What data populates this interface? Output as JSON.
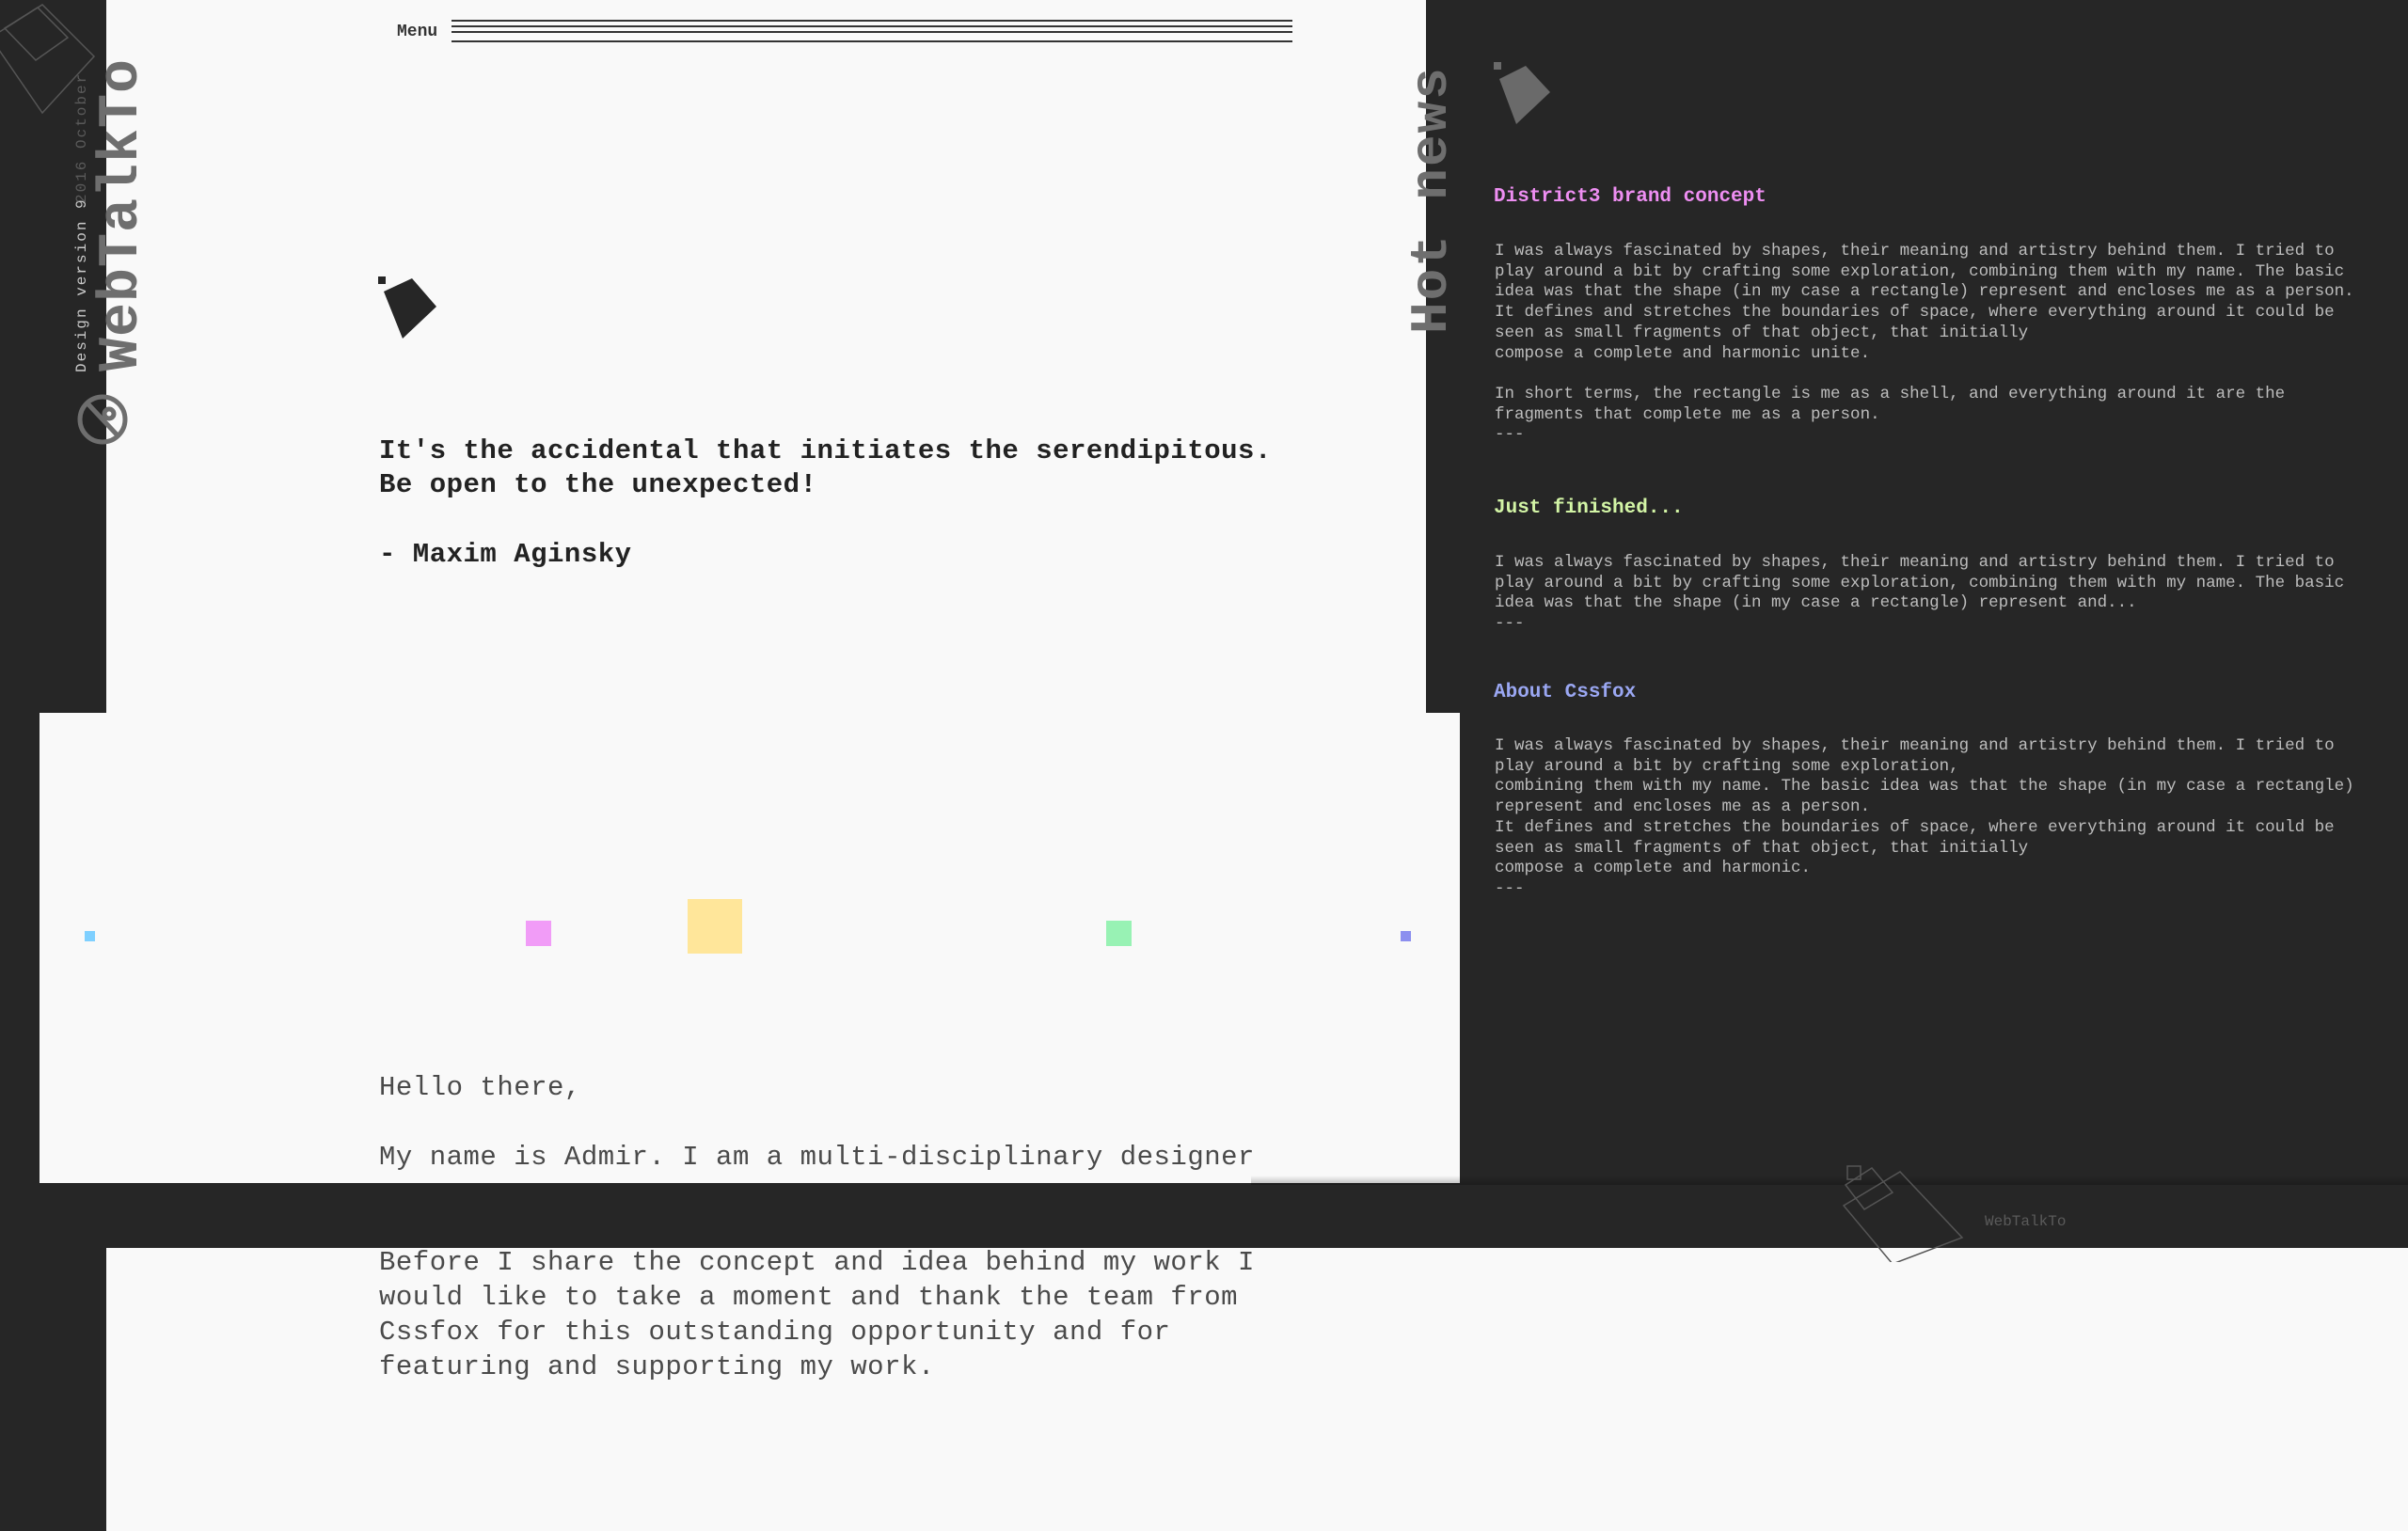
{
  "sidebar": {
    "brand": "WebTalkTo",
    "version": "Design version 9",
    "date": "2016 October"
  },
  "menu": {
    "label": "Menu"
  },
  "quote": {
    "text": "It's the accidental that initiates the serendipitous. Be open to the unexpected!",
    "author": "- Maxim Aginsky"
  },
  "intro": {
    "greeting": "Hello there,",
    "line": "My name is Admir. I am a multi-disciplinary designer",
    "thanks": "Before I share the concept and idea behind my work I would like to take a moment and thank the team from Cssfox for this outstanding opportunity and for featuring and supporting my work."
  },
  "news": {
    "title": "Hot news",
    "items": [
      {
        "heading": "District3 brand concept",
        "body": "I was always fascinated by shapes, their meaning and artistry behind them. I tried to play around a bit by crafting some exploration, combining them with my name. The basic idea was that the shape (in my case a rectangle) represent and encloses me as a person.\nIt defines and stretches the boundaries of space, where everything around it could be seen as small fragments of that object, that initially\ncompose a complete and harmonic unite.\n\nIn short terms, the rectangle is me as a shell, and everything around it are the fragments that complete me as a person.\n---"
      },
      {
        "heading": "Just finished...",
        "body": "I was always fascinated by shapes, their meaning and artistry behind them. I tried to play around a bit by crafting some exploration, combining them with my name. The basic idea was that the shape (in my case a rectangle) represent and...\n---"
      },
      {
        "heading": "About Cssfox",
        "body": "I was always fascinated by shapes, their meaning and artistry behind them. I tried to play around a bit by crafting some exploration,\ncombining them with my name. The basic idea was that the shape (in my case a rectangle) represent and encloses me as a person.\nIt defines and stretches the boundaries of space, where everything around it could be seen as small fragments of that object, that initially\ncompose a complete and harmonic.\n---"
      }
    ]
  },
  "footer": {
    "brand": "WebTalkTo"
  },
  "colors": {
    "dark": "#262626",
    "light": "#f9f9f9",
    "pink": "#ee8ef2",
    "lime": "#d3f5a6",
    "periwinkle": "#9aa7f2",
    "yellow": "#ffe69a",
    "green": "#98f2b4",
    "sky": "#7fd0ff"
  }
}
